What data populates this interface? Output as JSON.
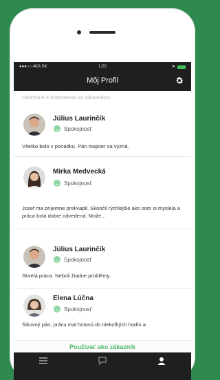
{
  "status": {
    "carrier": "●●●○○ 4KA SK",
    "time": "1:20"
  },
  "header": {
    "title": "Môj Profil"
  },
  "subtitle": "Obdržané 4 hodnotenia od zákazníkov",
  "reviews": [
    {
      "name": "Július Laurinčík",
      "rating": "Spokojnosť",
      "text": "Všetko bolo v poriadku. Pán majster sa vyzná."
    },
    {
      "name": "Mirka Medvecká",
      "rating": "Spokojnosť",
      "text": "Jozef ma príjemne prekvapil. Skončil rýchlejšie ako som si myslela a práca bola dobre odvedená. Može..."
    },
    {
      "name": "Július Laurinčík",
      "rating": "Spokojnosť",
      "text": "Skvelá práca. Neboli žiadne problémy."
    },
    {
      "name": "Elena Lúčna",
      "rating": "Spokojnosť",
      "text": "Šikovný pán, prácu mal hotovú do niekoľkých hodín a"
    }
  ],
  "cta": "Používať ako zákazník",
  "colors": {
    "accent": "#4ab86a",
    "background": "#2f8a4f",
    "bar": "#1f1f1f"
  },
  "icons": {
    "settings": "gear-icon",
    "tabs": [
      "list-icon",
      "chat-icon",
      "profile-icon"
    ]
  }
}
